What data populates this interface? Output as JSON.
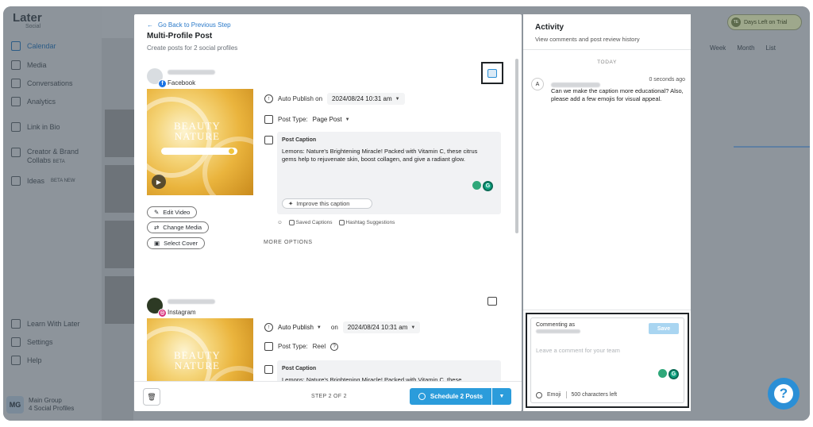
{
  "background_app": {
    "logo": "Later",
    "logo_sub": "Social",
    "trial_label": "Days Left on Trial",
    "trial_avatar": "TE",
    "nav": [
      {
        "label": "Calendar",
        "icon": "calendar-icon",
        "active": true
      },
      {
        "label": "Media",
        "icon": "media-icon"
      },
      {
        "label": "Conversations",
        "icon": "chat-icon"
      },
      {
        "label": "Analytics",
        "icon": "analytics-icon"
      },
      {
        "label": "Link in Bio",
        "icon": "link-icon"
      },
      {
        "label": "Creator & Brand Collabs",
        "badge": "BETA",
        "icon": "collabs-icon"
      },
      {
        "label": "Ideas",
        "badge": "BETA NEW",
        "icon": "ideas-icon"
      }
    ],
    "bottom_nav": [
      {
        "label": "Learn With Later",
        "icon": "book-icon"
      },
      {
        "label": "Settings",
        "icon": "gear-icon"
      },
      {
        "label": "Help",
        "icon": "help-icon"
      }
    ],
    "group": {
      "avatar": "MG",
      "name": "Main Group",
      "profiles": "4 Social Profiles"
    },
    "view_tabs": [
      "Week",
      "Month",
      "List"
    ]
  },
  "modal": {
    "back_link": "Go Back to Previous Step",
    "title": "Multi-Profile Post",
    "subtitle": "Create posts for 2 social profiles",
    "more_options": "MORE OPTIONS",
    "posts": [
      {
        "network": "Facebook",
        "network_badge": "f",
        "media_title_line1": "BEAUTY",
        "media_title_line2": "NATURE",
        "media_actions": [
          "Edit Video",
          "Change Media",
          "Select Cover"
        ],
        "publish_mode": "Auto Publish on",
        "publish_date": "2024/08/24 10:31 am",
        "post_type_label": "Post Type:",
        "post_type_value": "Page Post",
        "caption_label": "Post Caption",
        "caption_text": "Lemons: Nature's Brightening Miracle! Packed with Vitamin C, these citrus gems help to rejuvenate skin, boost collagen, and give a radiant glow.",
        "improve_label": "Improve this caption",
        "caption_tools": [
          "Saved Captions",
          "Hashtag Suggestions"
        ]
      },
      {
        "network": "Instagram",
        "network_badge": "◎",
        "media_title_line1": "BEAUTY",
        "media_title_line2": "NATURE",
        "publish_mode": "Auto Publish",
        "publish_on": "on",
        "publish_date": "2024/08/24 10:31 am",
        "post_type_label": "Post Type:",
        "post_type_value": "Reel",
        "caption_label": "Post Caption",
        "caption_text": "Lemons: Nature's Brightening Miracle! Packed with Vitamin C, these"
      }
    ],
    "footer": {
      "step": "STEP 2 OF 2",
      "schedule_label": "Schedule 2 Posts"
    }
  },
  "activity": {
    "title": "Activity",
    "subtitle": "View comments and post review history",
    "today_label": "TODAY",
    "comment": {
      "avatar": "A",
      "time": "0 seconds ago",
      "text": "Can we make the caption more educational? Also, please add a few emojis for visual appeal."
    },
    "compose": {
      "commenting_as": "Commenting as",
      "save_label": "Save",
      "placeholder": "Leave a comment for your team",
      "emoji_label": "Emoji",
      "chars_left": "500 characters left"
    }
  },
  "help_fab": "?",
  "colors": {
    "accent": "#2b9cdb",
    "link": "#2979c9",
    "overlay": "#8e959c",
    "caption_bg": "#f1f2f4"
  }
}
